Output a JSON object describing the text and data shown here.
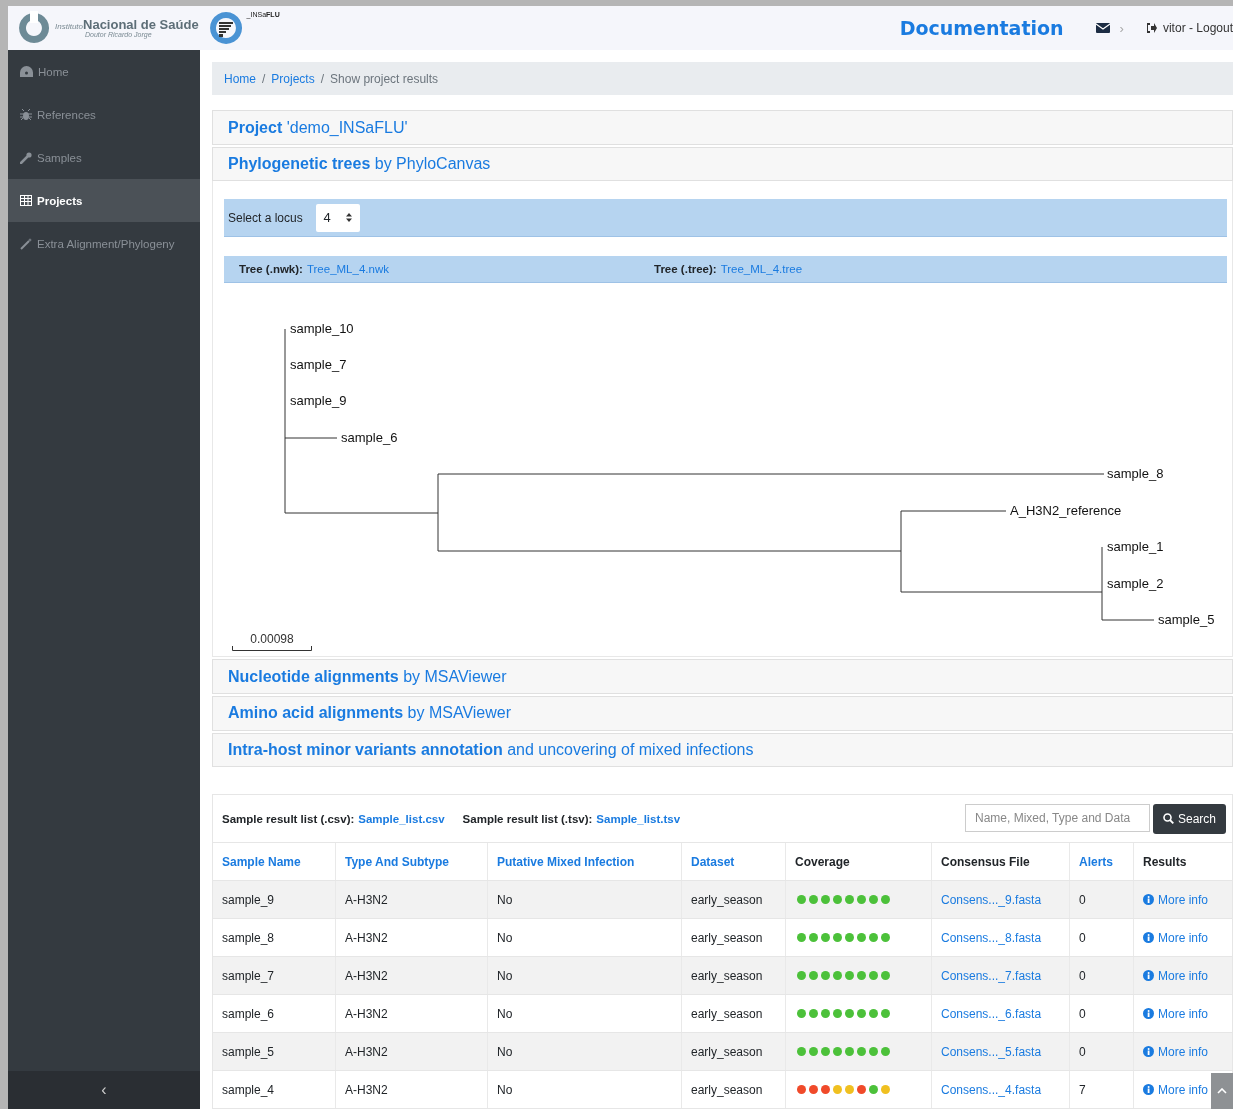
{
  "header": {
    "logo_small": "Instituto",
    "logo_main": "Nacional de Saúde",
    "logo_sub": "Doutor Ricardo Jorge",
    "app_logo": "_INSa**FLU**",
    "documentation": "Documentation",
    "chevron": "›",
    "user": "vitor - Logout"
  },
  "sidebar": {
    "items": [
      {
        "label": "Home",
        "selected": false
      },
      {
        "label": "References",
        "selected": false
      },
      {
        "label": "Samples",
        "selected": false
      },
      {
        "label": "Projects",
        "selected": true
      },
      {
        "label": "Extra Alignment/Phylogeny",
        "selected": false
      }
    ],
    "collapse": "‹"
  },
  "breadcrumb": {
    "separator": "/",
    "items": [
      {
        "label": "Home",
        "link": true
      },
      {
        "label": "Projects",
        "link": true
      },
      {
        "label": "Show project results",
        "link": false
      }
    ]
  },
  "project_heading": "**Project** 'demo_INSaFLU'",
  "tree_section": {
    "heading": "**Phylogenetic trees** by PhyloCanvas",
    "locus_label": "Select a locus",
    "locus_value": "4",
    "files": [
      {
        "label": "Tree (.nwk):",
        "link": "Tree_ML_4.nwk"
      },
      {
        "label": "Tree (.tree):",
        "link": "Tree_ML_4.tree"
      }
    ],
    "leaves": [
      "sample_10",
      "sample_7",
      "sample_9",
      "sample_6",
      "sample_8",
      "A_H3N2_reference",
      "sample_1",
      "sample_2",
      "sample_5"
    ],
    "scale": "0.00098"
  },
  "sections": [
    "**Nucleotide alignments** by MSAViewer",
    "**Amino acid alignments** by MSAViewer",
    "**Intra-host minor variants annotation** and uncovering of mixed infections"
  ],
  "results": {
    "lists": [
      {
        "label": "Sample result list (.csv):",
        "link": "Sample_list.csv"
      },
      {
        "label": "Sample result list (.tsv):",
        "link": "Sample_list.tsv"
      }
    ],
    "search": {
      "placeholder": "Name, Mixed, Type and Data",
      "button": "Search"
    },
    "columns": [
      {
        "label": "Sample Name",
        "sortable": true
      },
      {
        "label": "Type And Subtype",
        "sortable": true
      },
      {
        "label": "Putative Mixed Infection",
        "sortable": true
      },
      {
        "label": "Dataset",
        "sortable": true
      },
      {
        "label": "Coverage",
        "sortable": false
      },
      {
        "label": "Consensus File",
        "sortable": false
      },
      {
        "label": "Alerts",
        "sortable": true
      },
      {
        "label": "Results",
        "sortable": false
      }
    ],
    "rows": [
      {
        "name": "sample_9",
        "type": "A-H3N2",
        "mixed": "No",
        "dataset": "early_season",
        "coverage": [
          {
            "color": "#4cc13a"
          },
          {
            "color": "#4cc13a"
          },
          {
            "color": "#4cc13a"
          },
          {
            "color": "#4cc13a"
          },
          {
            "color": "#4cc13a"
          },
          {
            "color": "#4cc13a"
          },
          {
            "color": "#4cc13a"
          },
          {
            "color": "#4cc13a"
          }
        ],
        "consensus": "Consens..._9.fasta",
        "alerts": "0",
        "results": "More info"
      },
      {
        "name": "sample_8",
        "type": "A-H3N2",
        "mixed": "No",
        "dataset": "early_season",
        "coverage": [
          {
            "color": "#4cc13a"
          },
          {
            "color": "#4cc13a"
          },
          {
            "color": "#4cc13a"
          },
          {
            "color": "#4cc13a"
          },
          {
            "color": "#4cc13a"
          },
          {
            "color": "#4cc13a"
          },
          {
            "color": "#4cc13a"
          },
          {
            "color": "#4cc13a"
          }
        ],
        "consensus": "Consens..._8.fasta",
        "alerts": "0",
        "results": "More info"
      },
      {
        "name": "sample_7",
        "type": "A-H3N2",
        "mixed": "No",
        "dataset": "early_season",
        "coverage": [
          {
            "color": "#4cc13a"
          },
          {
            "color": "#4cc13a"
          },
          {
            "color": "#4cc13a"
          },
          {
            "color": "#4cc13a"
          },
          {
            "color": "#4cc13a"
          },
          {
            "color": "#4cc13a"
          },
          {
            "color": "#4cc13a"
          },
          {
            "color": "#4cc13a"
          }
        ],
        "consensus": "Consens..._7.fasta",
        "alerts": "0",
        "results": "More info"
      },
      {
        "name": "sample_6",
        "type": "A-H3N2",
        "mixed": "No",
        "dataset": "early_season",
        "coverage": [
          {
            "color": "#4cc13a"
          },
          {
            "color": "#4cc13a"
          },
          {
            "color": "#4cc13a"
          },
          {
            "color": "#4cc13a"
          },
          {
            "color": "#4cc13a"
          },
          {
            "color": "#4cc13a"
          },
          {
            "color": "#4cc13a"
          },
          {
            "color": "#4cc13a"
          }
        ],
        "consensus": "Consens..._6.fasta",
        "alerts": "0",
        "results": "More info"
      },
      {
        "name": "sample_5",
        "type": "A-H3N2",
        "mixed": "No",
        "dataset": "early_season",
        "coverage": [
          {
            "color": "#4cc13a"
          },
          {
            "color": "#4cc13a"
          },
          {
            "color": "#4cc13a"
          },
          {
            "color": "#4cc13a"
          },
          {
            "color": "#4cc13a"
          },
          {
            "color": "#4cc13a"
          },
          {
            "color": "#4cc13a"
          },
          {
            "color": "#4cc13a"
          }
        ],
        "consensus": "Consens..._5.fasta",
        "alerts": "0",
        "results": "More info"
      },
      {
        "name": "sample_4",
        "type": "A-H3N2",
        "mixed": "No",
        "dataset": "early_season",
        "coverage": [
          {
            "color": "#f04a2a"
          },
          {
            "color": "#f04a2a"
          },
          {
            "color": "#f04a2a"
          },
          {
            "color": "#f0c020"
          },
          {
            "color": "#f0c020"
          },
          {
            "color": "#f04a2a"
          },
          {
            "color": "#4cc13a"
          },
          {
            "color": "#f0c020"
          }
        ],
        "consensus": "Consens..._4.fasta",
        "alerts": "7",
        "results": "More info"
      }
    ]
  }
}
